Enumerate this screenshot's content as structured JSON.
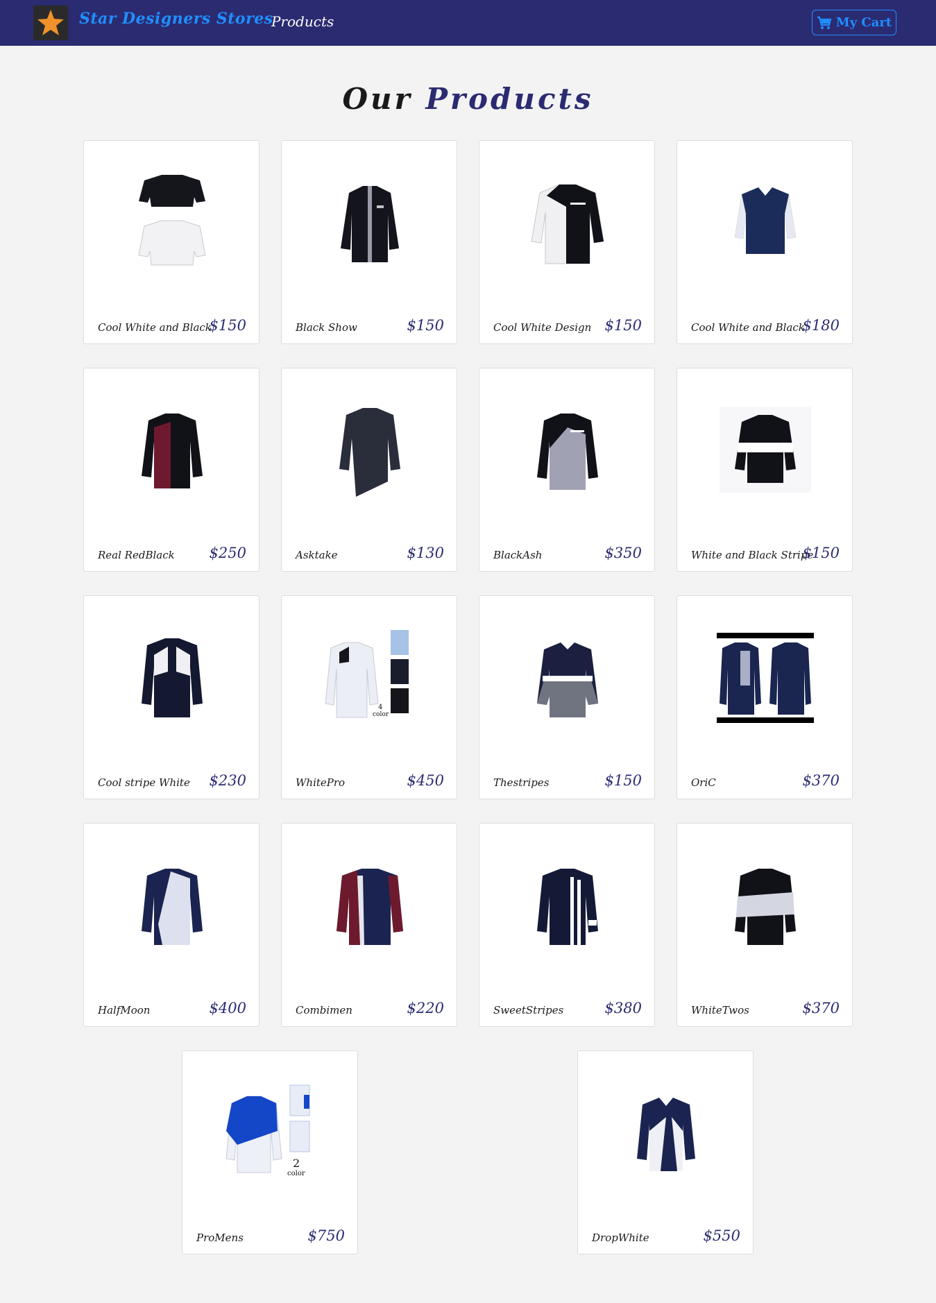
{
  "navbar": {
    "brand": "Star Designers Stores",
    "nav_link": "Products",
    "cart_label": "My Cart",
    "brand_color": "#1f8fff",
    "bg_color": "#2b2b72"
  },
  "heading": {
    "word1": "Our",
    "word2": "Products"
  },
  "products": [
    {
      "name": "Cool White and Black",
      "price": "$150",
      "icon": "two-shirts-black-white"
    },
    {
      "name": "Black Show",
      "price": "$150",
      "icon": "black-shirt"
    },
    {
      "name": "Cool White Design",
      "price": "$150",
      "icon": "white-black-shirt"
    },
    {
      "name": "Cool White and Black",
      "price": "$180",
      "icon": "navy-dotted-shirt"
    },
    {
      "name": "Real RedBlack",
      "price": "$250",
      "icon": "red-black-shirt"
    },
    {
      "name": "Asktake",
      "price": "$130",
      "icon": "dark-gray-shirt"
    },
    {
      "name": "BlackAsh",
      "price": "$350",
      "icon": "black-ash-shirt"
    },
    {
      "name": "White and Black Stripe",
      "price": "$150",
      "icon": "white-stripe-shirt"
    },
    {
      "name": "Cool stripe White",
      "price": "$230",
      "icon": "navy-white-shoulder-shirt"
    },
    {
      "name": "WhitePro",
      "price": "$450",
      "icon": "white-pro-shirt"
    },
    {
      "name": "Thestripes",
      "price": "$150",
      "icon": "gray-navy-shirt"
    },
    {
      "name": "OriC",
      "price": "$370",
      "icon": "two-navy-shirts"
    },
    {
      "name": "HalfMoon",
      "price": "$400",
      "icon": "navy-white-half-shirt"
    },
    {
      "name": "Combimen",
      "price": "$220",
      "icon": "maroon-navy-shirt"
    },
    {
      "name": "SweetStripes",
      "price": "$380",
      "icon": "navy-stripes-shirt"
    },
    {
      "name": "WhiteTwos",
      "price": "$370",
      "icon": "black-white-band-shirt"
    },
    {
      "name": "ProMens",
      "price": "$750",
      "icon": "blue-white-shirt"
    },
    {
      "name": "DropWhite",
      "price": "$550",
      "icon": "navy-drop-white-shirt"
    }
  ],
  "image_text": {
    "whitepro_badge_num": "4",
    "whitepro_badge_word": "color",
    "promens_badge_num": "2",
    "promens_badge_word": "color"
  }
}
